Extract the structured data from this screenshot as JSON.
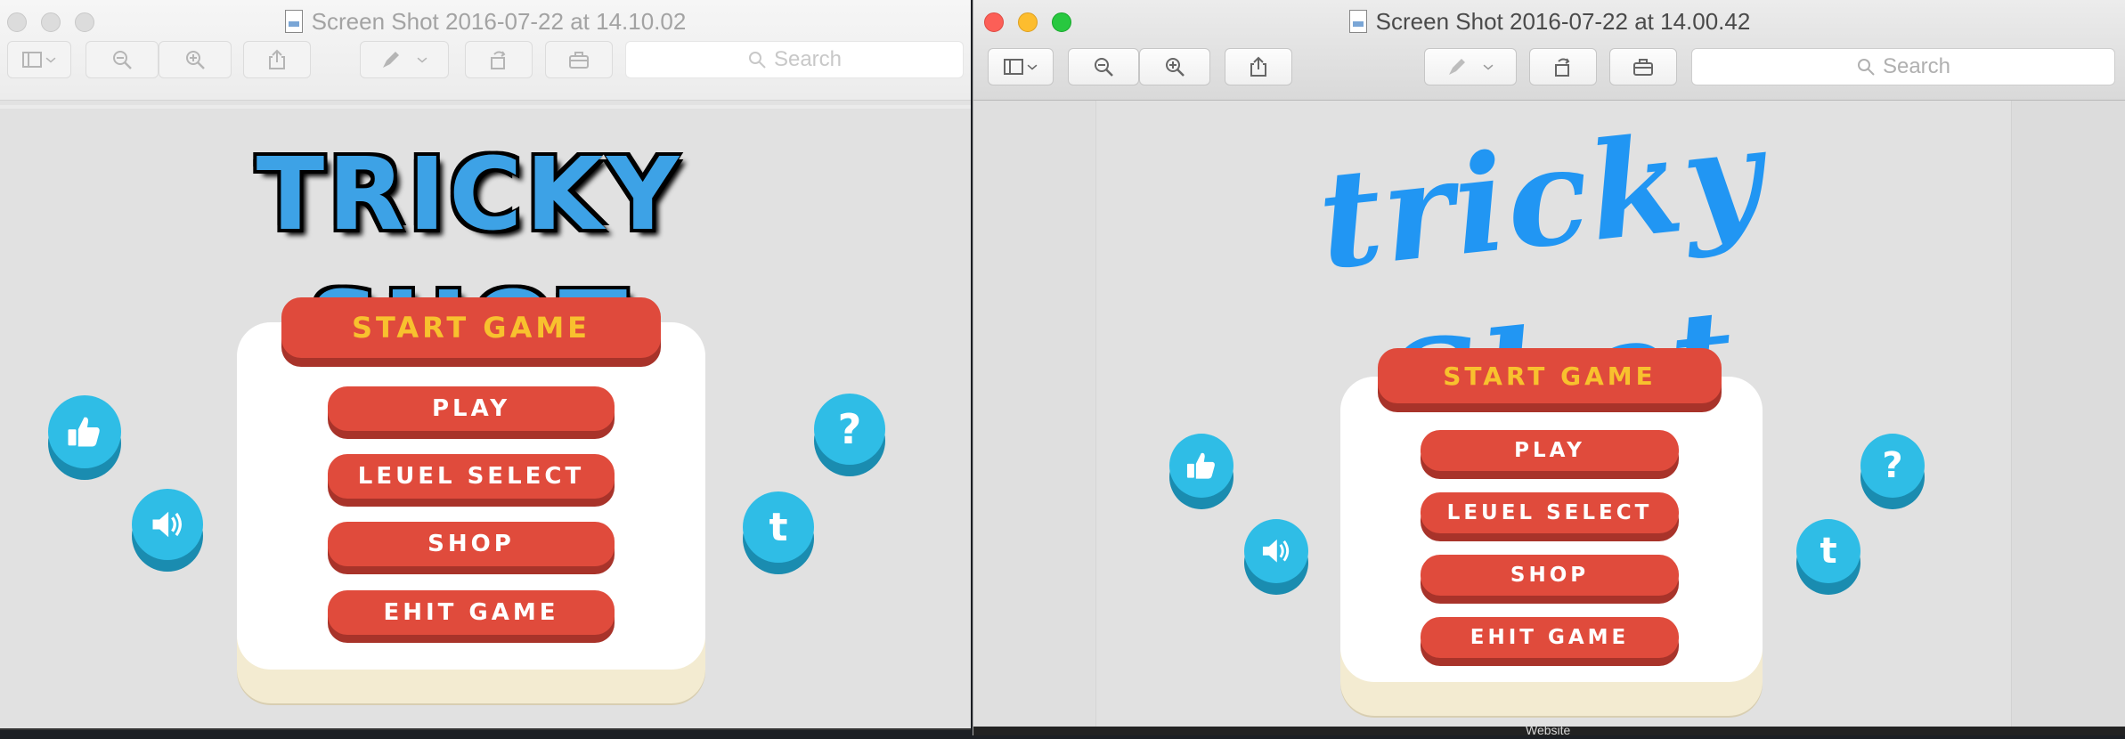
{
  "windowA": {
    "title": "Screen Shot 2016-07-22 at 14.10.02",
    "search_placeholder": "Search",
    "logo_text": "TRICKY SHOT"
  },
  "windowB": {
    "title": "Screen Shot 2016-07-22 at 14.00.42",
    "search_placeholder": "Search",
    "logo_text": "tricky Shot"
  },
  "menu": {
    "start": "START GAME",
    "play": "PLAY",
    "level_select": "LEUEL SELECT",
    "shop": "SHOP",
    "exit": "EHIT GAME"
  },
  "icons": {
    "toolbar": [
      "sidebar-icon",
      "chevron-down-icon",
      "zoom-out-icon",
      "zoom-in-icon",
      "share-icon",
      "markup-pen-icon",
      "rotate-icon",
      "toolbox-icon",
      "search-icon"
    ],
    "game": [
      "thumbs-up-icon",
      "speaker-icon",
      "help-icon",
      "twitter-icon"
    ]
  },
  "colors": {
    "button_red": "#e04b3c",
    "start_text": "#f8c12e",
    "circle_blue": "#2fbde6",
    "logo_blue": "#2196f3"
  },
  "background_text": {
    "taskbar_label": "Website"
  }
}
